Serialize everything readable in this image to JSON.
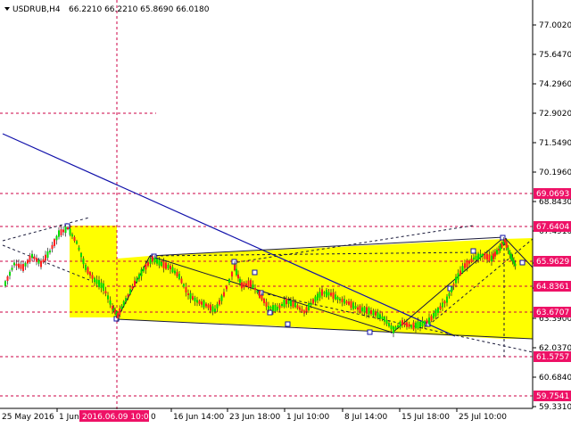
{
  "header": {
    "symbol_timeframe": "USDRUB,H4",
    "ohlc": "66.2210 66.2210 65.8690 66.0180"
  },
  "colors": {
    "bull_candle": "#00dd00",
    "bear_candle": "#ff2020",
    "highlight_zone": "#ffff00",
    "trend_line": "#1010aa",
    "level_line": "#cc0044",
    "level_tag": "#ee1166"
  },
  "price_axis": {
    "ticks": [
      "77.0020",
      "75.6470",
      "74.2960",
      "72.9020",
      "71.5490",
      "70.1960",
      "68.8430",
      "67.4910",
      "65.9629",
      "64.7840",
      "63.3900",
      "62.0370",
      "60.6840",
      "59.3310"
    ],
    "tagged_levels": [
      "69.0693",
      "67.6404",
      "65.9629",
      "64.8361",
      "63.6707",
      "61.5757",
      "59.7541"
    ]
  },
  "time_axis": {
    "labels": [
      "25 May 2016",
      "1 Jun",
      "16 Jun 14:00",
      "23 Jun 18:00",
      "1 Jul 10:00",
      "8 Jul 14:00",
      "15 Jul 18:00",
      "25 Jul 10:00"
    ],
    "cursor_label": "2016.06.09 10:00",
    "cursor_tail": "0"
  },
  "chart_data": {
    "type": "candlestick",
    "symbol": "USDRUB",
    "timeframe": "H4",
    "last_bar": {
      "open": 66.221,
      "high": 66.221,
      "low": 65.869,
      "close": 66.018
    },
    "y_range": [
      58.9,
      78.3
    ],
    "horizontal_levels": [
      69.0693,
      67.6404,
      65.9629,
      64.8361,
      63.6707,
      61.5757,
      59.7541,
      72.902
    ]
  }
}
